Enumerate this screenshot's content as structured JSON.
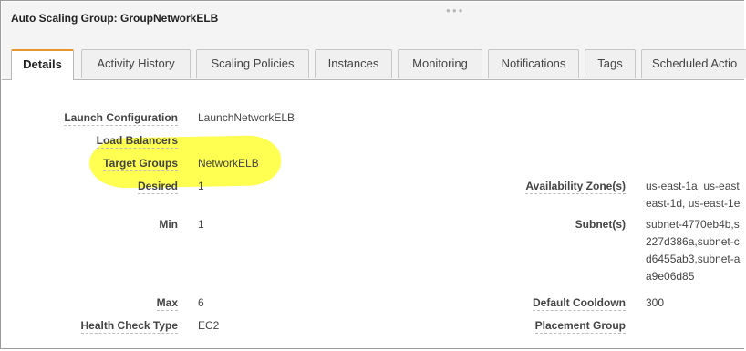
{
  "header": {
    "title": "Auto Scaling Group: GroupNetworkELB"
  },
  "tabs": [
    {
      "label": "Details"
    },
    {
      "label": "Activity History"
    },
    {
      "label": "Scaling Policies"
    },
    {
      "label": "Instances"
    },
    {
      "label": "Monitoring"
    },
    {
      "label": "Notifications"
    },
    {
      "label": "Tags"
    },
    {
      "label": "Scheduled Actio"
    }
  ],
  "details": {
    "launch_config_label": "Launch Configuration",
    "launch_config_value": "LaunchNetworkELB",
    "load_balancers_label": "Load Balancers",
    "target_groups_label": "Target Groups",
    "target_groups_value": "NetworkELB",
    "desired_label": "Desired",
    "desired_value": "1",
    "min_label": "Min",
    "min_value": "1",
    "max_label": "Max",
    "max_value": "6",
    "health_check_type_label": "Health Check Type",
    "health_check_type_value": "EC2",
    "az_label": "Availability Zone(s)",
    "az_line1": "us-east-1a, us-east",
    "az_line2": "east-1d, us-east-1e",
    "subnets_label": "Subnet(s)",
    "subnets_line1": "subnet-4770eb4b,s",
    "subnets_line2": "227d386a,subnet-c",
    "subnets_line3": "d6455ab3,subnet-a",
    "subnets_line4": "a9e06d85",
    "cooldown_label": "Default Cooldown",
    "cooldown_value": "300",
    "placement_group_label": "Placement Group"
  },
  "colors": {
    "active_tab_accent": "#e8952b",
    "highlight": "#ffff33"
  }
}
